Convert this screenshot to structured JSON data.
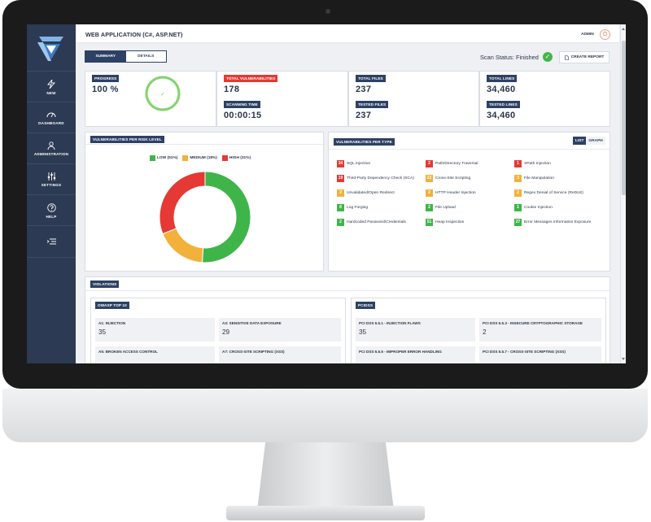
{
  "app": {
    "title": "WEB APPLICATION (C#, ASP.NET)",
    "user": "ADMIN"
  },
  "sidebar": {
    "items": [
      {
        "label": "NEW",
        "icon": "lightning-icon"
      },
      {
        "label": "DASHBOARD",
        "icon": "gauge-icon"
      },
      {
        "label": "ADMINISTRATION",
        "icon": "user-icon"
      },
      {
        "label": "SETTINGS",
        "icon": "sliders-icon"
      },
      {
        "label": "HELP",
        "icon": "question-icon"
      },
      {
        "label": "",
        "icon": "menu-collapse-icon"
      }
    ]
  },
  "tabs": [
    {
      "label": "SUMMARY"
    },
    {
      "label": "DETAILS"
    }
  ],
  "scan": {
    "status_text": "Scan Status: Finished"
  },
  "actions": {
    "create_report": "CREATE REPORT"
  },
  "summary": {
    "progress": {
      "label": "PROGRESS",
      "value": "100 %",
      "fraction": 1.0
    },
    "total_vulnerabilities": {
      "label": "TOTAL VULNERABILITIES",
      "value": "178"
    },
    "scanning_time": {
      "label": "SCANNING TIME",
      "value": "00:00:15"
    },
    "total_files": {
      "label": "TOTAL FILES",
      "value": "237"
    },
    "tested_files": {
      "label": "TESTED FILES",
      "value": "237"
    },
    "total_lines": {
      "label": "TOTAL LINES",
      "value": "34,460"
    },
    "tested_lines": {
      "label": "TESTED LINES",
      "value": "34,460"
    }
  },
  "risk_panel": {
    "title": "VULNERABILITIES PER RISK LEVEL"
  },
  "chart_data": {
    "type": "pie",
    "title": "VULNERABILITIES PER RISK LEVEL",
    "categories": [
      "LOW (51%)",
      "MEDIUM (18%)",
      "HIGH (31%)"
    ],
    "values": [
      51,
      18,
      31
    ],
    "colors": [
      "#3fb549",
      "#f2b13a",
      "#e53935"
    ],
    "legend": "top"
  },
  "type_panel": {
    "title": "VULNERABILITIES PER TYPE",
    "toggle_list": "LIST",
    "toggle_graph": "GRAPH",
    "items": [
      {
        "count": "34",
        "label": "SQL Injection",
        "color": "#e53935"
      },
      {
        "count": "2",
        "label": "Path/Directory Traversal",
        "color": "#e53935"
      },
      {
        "count": "1",
        "label": "XPath Injection",
        "color": "#e53935"
      },
      {
        "count": "19",
        "label": "Third-Party Dependency Check (SCA)",
        "color": "#e53935"
      },
      {
        "count": "22",
        "label": "Cross-Site Scripting",
        "color": "#f2b13a"
      },
      {
        "count": "3",
        "label": "File Manipulation",
        "color": "#f2b13a"
      },
      {
        "count": "2",
        "label": "Unvalidated/Open Redirect",
        "color": "#f2b13a"
      },
      {
        "count": "2",
        "label": "HTTP Header Injection",
        "color": "#f2b13a"
      },
      {
        "count": "2",
        "label": "Regex Denial of Service (ReDoS)",
        "color": "#f2b13a"
      },
      {
        "count": "8",
        "label": "Log Forging",
        "color": "#3fb549"
      },
      {
        "count": "2",
        "label": "File Upload",
        "color": "#3fb549"
      },
      {
        "count": "1",
        "label": "Cookie Injection",
        "color": "#3fb549"
      },
      {
        "count": "2",
        "label": "Hardcoded Password/Credentials",
        "color": "#3fb549"
      },
      {
        "count": "51",
        "label": "Heap Inspection",
        "color": "#3fb549"
      },
      {
        "count": "27",
        "label": "Error Messages Information Exposure",
        "color": "#3fb549"
      }
    ]
  },
  "violations": {
    "title": "VIOLATIONS",
    "owasp": {
      "title": "OWASP TOP 10",
      "cells": [
        {
          "label": "A1: INJECTION",
          "value": "35"
        },
        {
          "label": "A3: SENSITIVE DATA EXPOSURE",
          "value": "29"
        },
        {
          "label": "A5: BROKEN ACCESS CONTROL",
          "value": ""
        },
        {
          "label": "A7: CROSS-SITE SCRIPTING (XSS)",
          "value": ""
        }
      ]
    },
    "pcidss": {
      "title": "PCIDSS",
      "cells": [
        {
          "label": "PCI DSS 6.5.1 - INJECTION FLAWS",
          "value": "35"
        },
        {
          "label": "PCI DSS 6.5.3 - INSECURE CRYPTOGRAPHIC STORAGE",
          "value": "2"
        },
        {
          "label": "PCI DSS 6.5.5 - IMPROPER ERROR HANDLING",
          "value": ""
        },
        {
          "label": "PCI DSS 6.5.7 - CROSS-SITE SCRIPTING (XSS)",
          "value": ""
        }
      ]
    }
  }
}
